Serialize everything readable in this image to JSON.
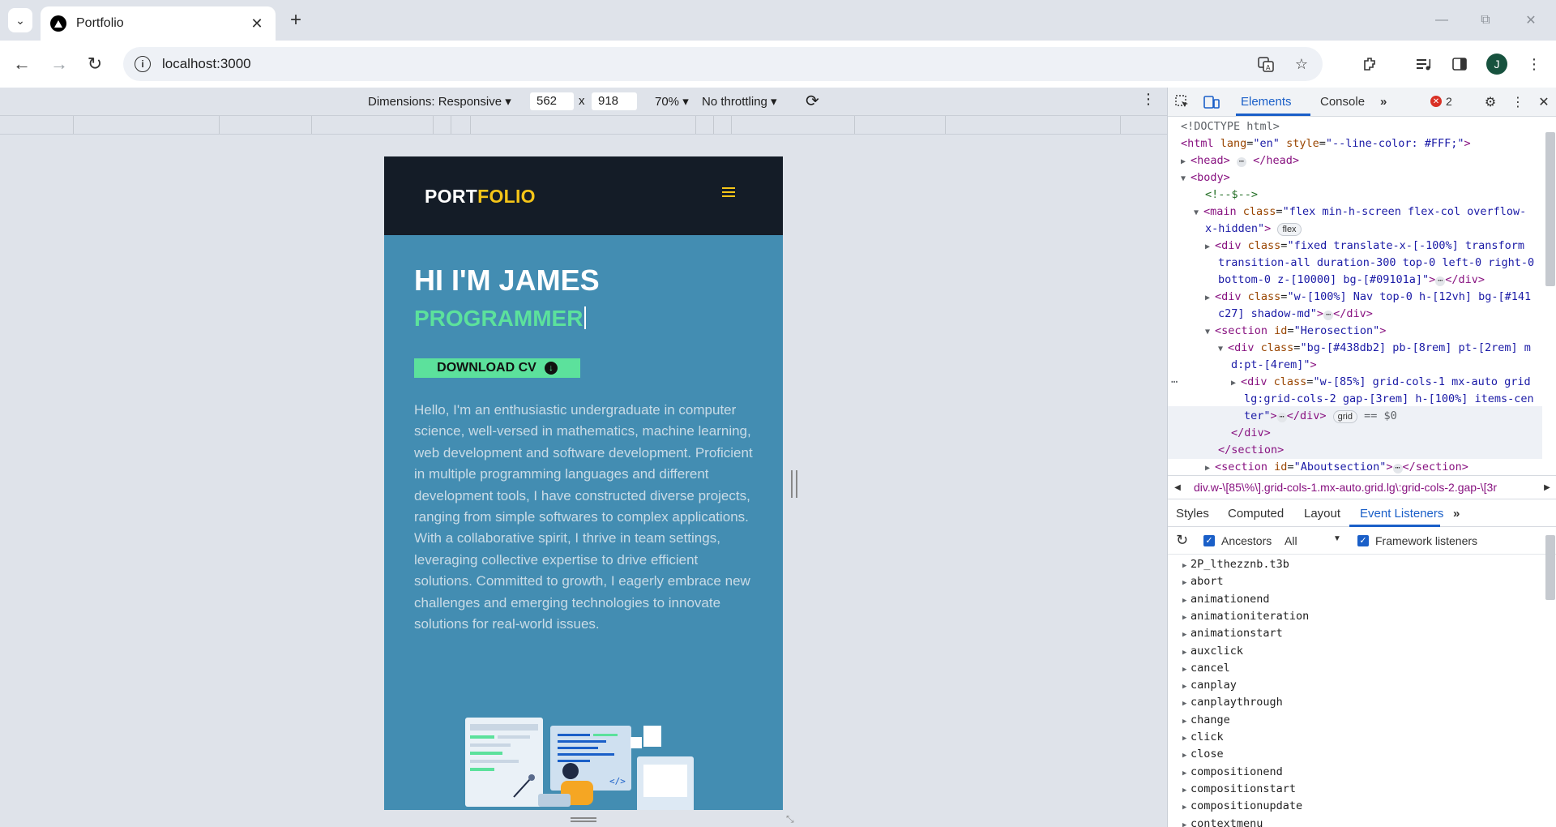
{
  "browser": {
    "tab_title": "Portfolio",
    "url": "localhost:3000",
    "avatar_letter": "J"
  },
  "device_toolbar": {
    "dimensions": "Dimensions: Responsive",
    "width": "562",
    "times": "x",
    "height": "918",
    "zoom": "70%",
    "throttling": "No throttling"
  },
  "site": {
    "logo_a": "PORT",
    "logo_b": "FOLIO",
    "hero_title": "HI I'M JAMES",
    "hero_role": "PROGRAMMER",
    "cv_button": "DOWNLOAD CV",
    "hero_text": "Hello, I'm an enthusiastic undergraduate in computer science, well-versed in mathematics, machine learning, web development and software development. Proficient in multiple programming languages and different development tools, I have constructed diverse projects, ranging from simple softwares to complex applications. With a collaborative spirit, I thrive in team settings, leveraging collective expertise to drive efficient solutions. Committed to growth, I eagerly embrace new challenges and emerging technologies to innovate solutions for real-world issues."
  },
  "devtools": {
    "tabs": [
      "Elements",
      "Console"
    ],
    "error_count": "2",
    "dom": {
      "doctype": "<!DOCTYPE html>",
      "html_open": "<html",
      "html_attr": " lang",
      "html_attr_val": "\"en\"",
      "html_style": " style",
      "html_style_val": "\"--line-color: #FFF;\"",
      "head": "<head>",
      "head_close": "</head>",
      "body": "<body>",
      "comment": "<!--$-->",
      "main_tag": "<main",
      "main_class_val": "\"flex min-h-screen flex-col overflow-",
      "main_class_val2": "x-hidden\"",
      "flex_pill": "flex",
      "div1_val": "\"fixed translate-x-[-100%] transform",
      "div1_val2": "transition-all duration-300 top-0 left-0 right-0",
      "div1_val3": "bottom-0 z-[10000] bg-[#09101a]\"",
      "div2_val": "\"w-[100%] Nav top-0 h-[12vh] bg-[#141",
      "div2_val2": "c27] shadow-md\"",
      "section_val": "\"Herosection\"",
      "div3_val": "\"bg-[#438db2] pb-[8rem] pt-[2rem] m",
      "div3_val2": "d:pt-[4rem]\"",
      "div4_val": "\"w-[85%] grid-cols-1 mx-auto grid",
      "div4_val2": "lg:grid-cols-2 gap-[3rem] h-[100%] items-cen",
      "div4_val3": "ter\"",
      "grid_pill": "grid",
      "eq": "== $0",
      "div_close": "</div>",
      "section_close": "</section>",
      "about_val": "\"Aboutsection\""
    },
    "breadcrumb": "div.w-\\[85\\%\\].grid-cols-1.mx-auto.grid.lg\\:grid-cols-2.gap-\\[3r",
    "subtabs": [
      "Styles",
      "Computed",
      "Layout",
      "Event Listeners"
    ],
    "filters": {
      "ancestors": "Ancestors",
      "all": "All",
      "framework": "Framework listeners"
    },
    "events": [
      "2P_lthezznb.t3b",
      "abort",
      "animationend",
      "animationiteration",
      "animationstart",
      "auxclick",
      "cancel",
      "canplay",
      "canplaythrough",
      "change",
      "click",
      "close",
      "compositionend",
      "compositionstart",
      "compositionupdate",
      "contextmenu"
    ]
  }
}
